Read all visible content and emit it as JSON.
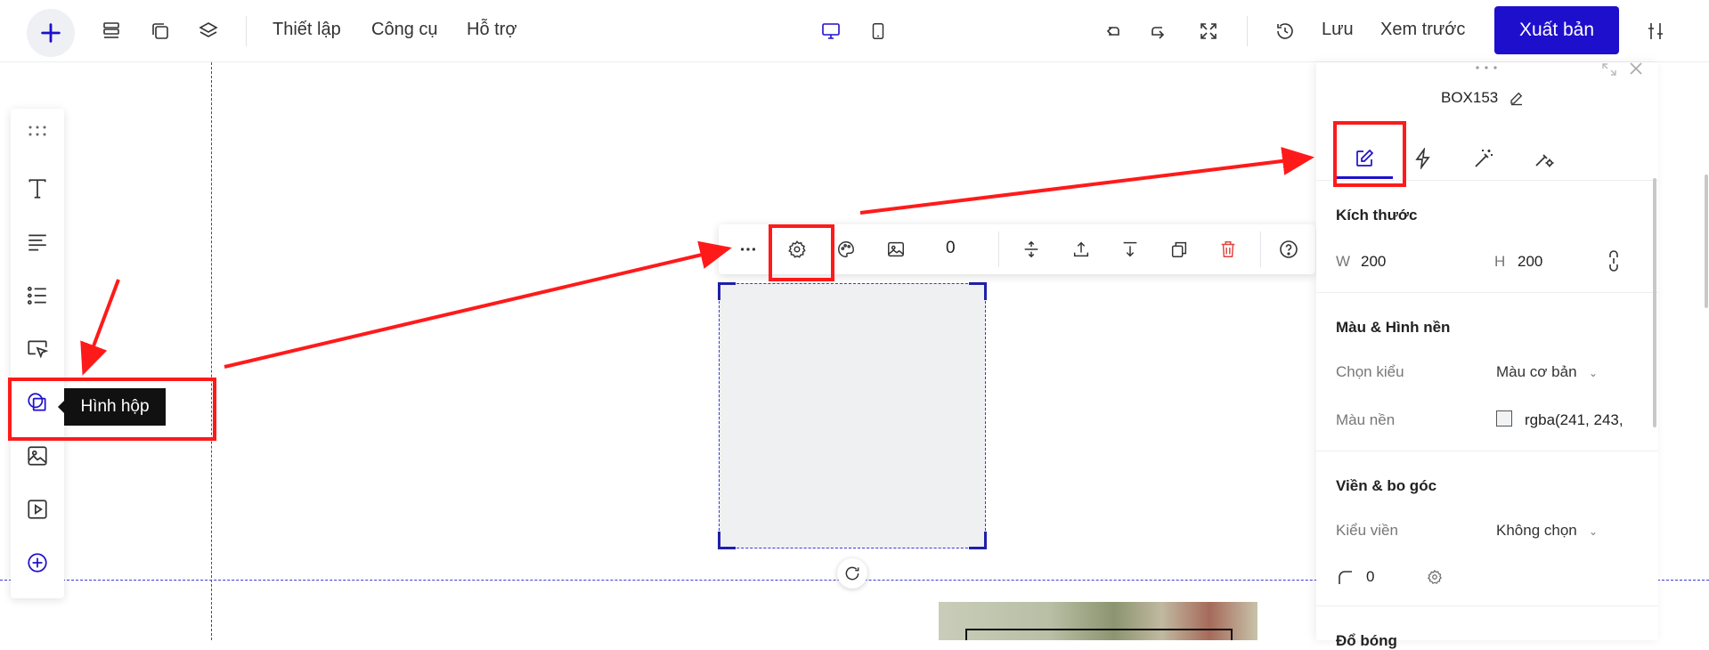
{
  "colors": {
    "accent": "#1e0fcc",
    "guide": "#3a3ad6",
    "annotation": "#ff1a1a",
    "delete": "#e0443b"
  },
  "topbar": {
    "icons": [
      "plus-icon",
      "sections-icon",
      "pages-icon",
      "layers-icon",
      "desktop-icon",
      "mobile-icon",
      "undo-icon",
      "redo-icon",
      "fullscreen-icon",
      "history-icon",
      "settings-sliders-icon"
    ],
    "menu": [
      "Thiết lập",
      "Công cụ",
      "Hỗ trợ"
    ],
    "save_label": "Lưu",
    "preview_label": "Xem trước",
    "publish_label": "Xuất bản"
  },
  "left_toolbar": {
    "items": [
      "drag-handle-icon",
      "text-icon",
      "paragraph-icon",
      "list-icon",
      "button-icon",
      "box-icon",
      "image-icon",
      "video-icon",
      "add-more-icon"
    ],
    "tooltip": "Hình hộp"
  },
  "element_toolbar": {
    "icons": [
      "more-icon",
      "gear-icon",
      "palette-icon",
      "image-icon",
      "stretch-vertical-icon",
      "bring-up-icon",
      "send-down-icon",
      "duplicate-icon",
      "trash-icon",
      "help-icon"
    ],
    "count": "0"
  },
  "panel": {
    "element_name": "BOX153",
    "tabs": [
      "design-tab",
      "events-tab",
      "effects-tab",
      "advanced-tab"
    ],
    "size": {
      "title": "Kích thước",
      "w_label": "W",
      "w_value": "200",
      "h_label": "H",
      "h_value": "200"
    },
    "background": {
      "title": "Màu & Hình nền",
      "type_label": "Chọn kiểu",
      "type_value": "Màu cơ bản",
      "color_label": "Màu nền",
      "color_value": "rgba(241, 243,",
      "swatch": "#f1f3f5"
    },
    "border": {
      "title": "Viền & bo góc",
      "style_label": "Kiểu viền",
      "style_value": "Không chọn",
      "radius_value": "0"
    },
    "shadow": {
      "title": "Đổ bóng"
    }
  }
}
